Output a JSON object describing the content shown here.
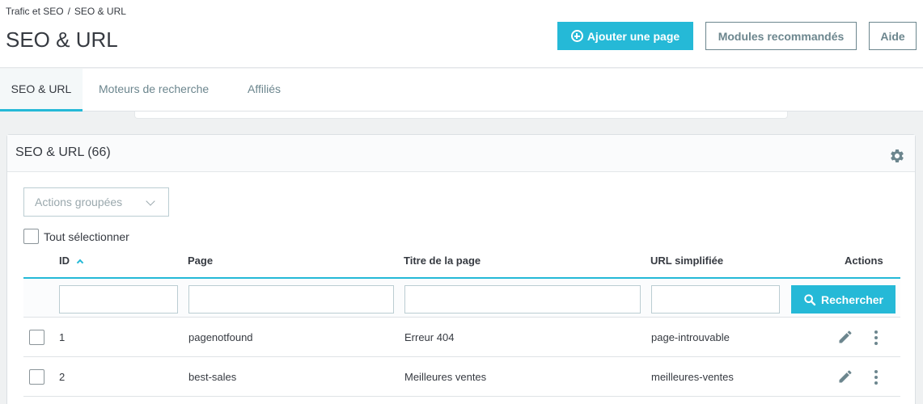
{
  "breadcrumb": {
    "parent": "Trafic et SEO",
    "separator": "/",
    "current": "SEO & URL"
  },
  "header": {
    "title": "SEO & URL",
    "add_page_label": "Ajouter une page",
    "modules_label": "Modules recommandés",
    "help_label": "Aide"
  },
  "tabs": [
    {
      "label": "SEO & URL",
      "active": true
    },
    {
      "label": "Moteurs de recherche",
      "active": false
    },
    {
      "label": "Affiliés",
      "active": false
    }
  ],
  "panel": {
    "title": "SEO & URL (66)",
    "bulk_actions_label": "Actions groupées",
    "select_all_label": "Tout sélectionner"
  },
  "table": {
    "columns": [
      "ID",
      "Page",
      "Titre de la page",
      "URL simplifiée",
      "Actions"
    ],
    "sort": {
      "column": "ID",
      "direction": "asc"
    },
    "search_label": "Rechercher",
    "rows": [
      {
        "id": "1",
        "page": "pagenotfound",
        "title": "Erreur 404",
        "url": "page-introuvable"
      },
      {
        "id": "2",
        "page": "best-sales",
        "title": "Meilleures ventes",
        "url": "meilleures-ventes"
      }
    ]
  },
  "colors": {
    "accent": "#25b9d7",
    "text": "#363a41",
    "muted": "#6c868e"
  },
  "icons": [
    "plus-circle-icon",
    "gear-icon",
    "chevron-down-icon",
    "sort-up-icon",
    "search-icon",
    "pencil-icon",
    "more-vert-icon"
  ]
}
